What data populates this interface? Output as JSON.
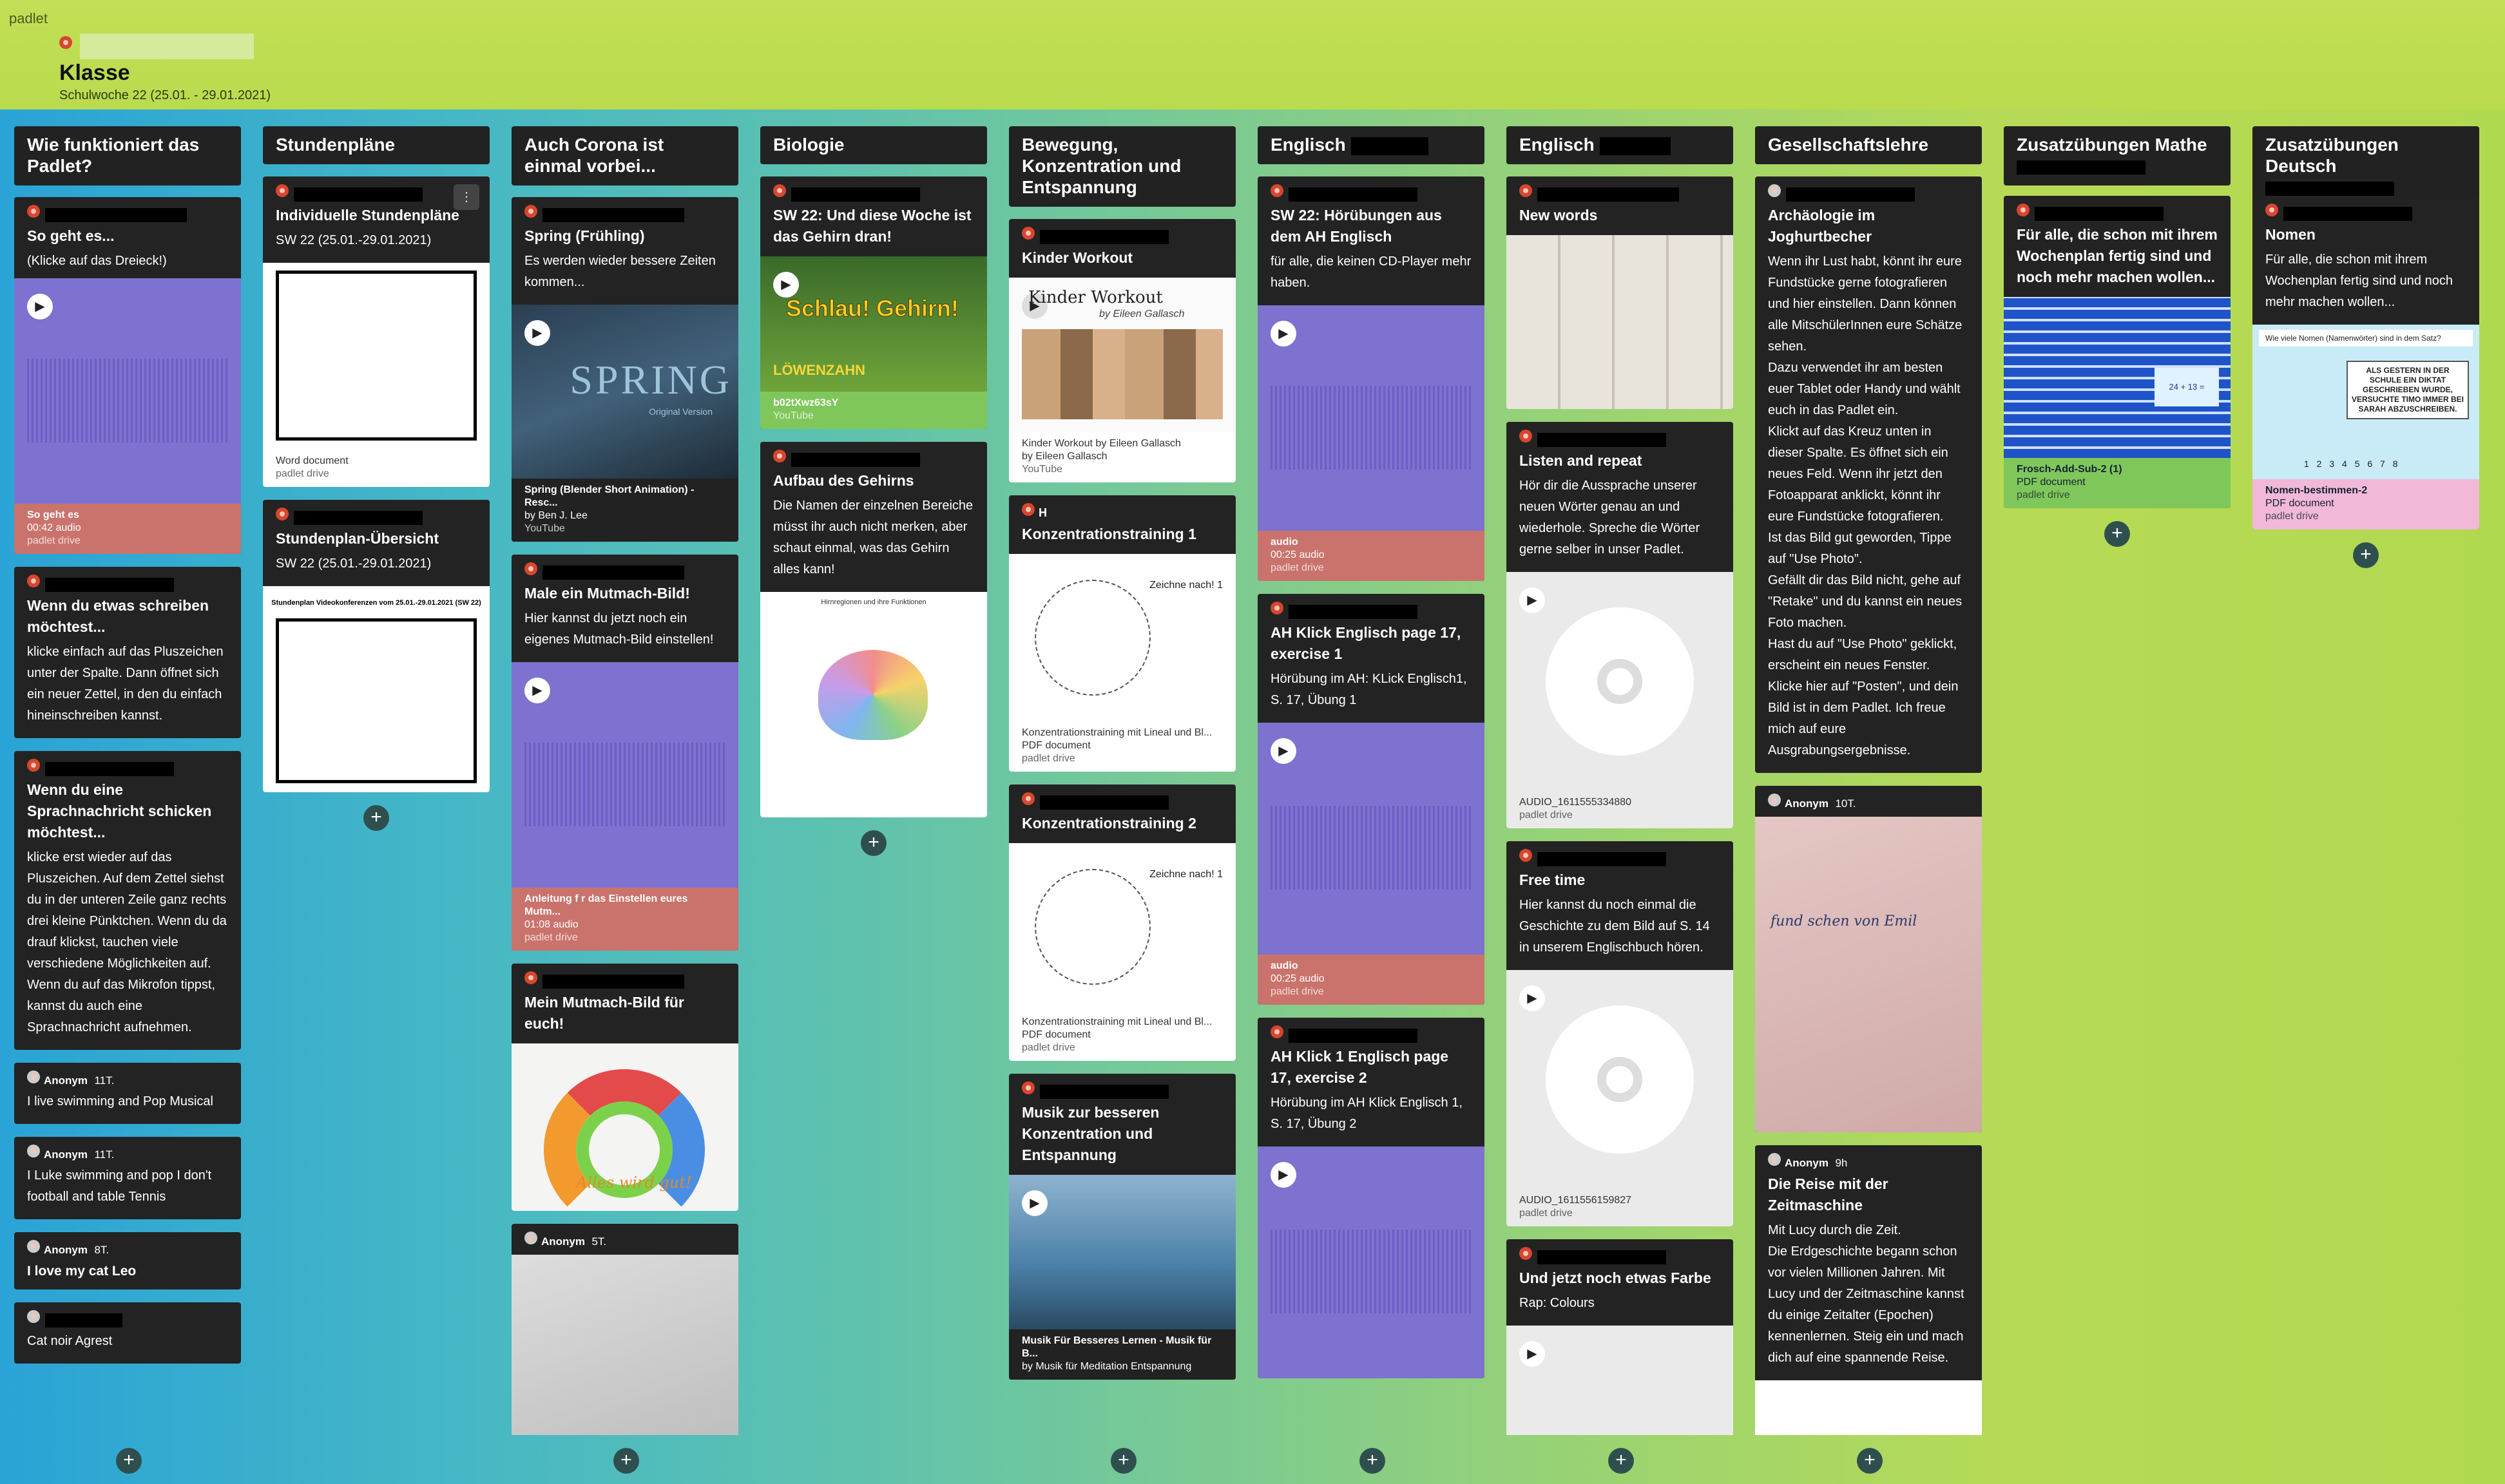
{
  "app": {
    "name": "padlet"
  },
  "header": {
    "title": "Klasse",
    "subtitle": "Schulwoche 22 (25.01. - 29.01.2021)"
  },
  "columns": [
    {
      "title": "Wie funktioniert das Padlet?",
      "posts": [
        {
          "title": "So geht es...",
          "body": "(Klicke auf das Dreieck!)",
          "att_name": "So geht es",
          "att_meta": "00:42 audio",
          "att_src": "padlet drive"
        },
        {
          "title": "Wenn du etwas schreiben möchtest...",
          "body": "klicke einfach auf das Pluszeichen unter der Spalte. Dann öffnet sich ein neuer Zettel, in den du einfach hineinschreiben kannst."
        },
        {
          "title": "Wenn du eine Sprachnachricht schicken möchtest...",
          "body": "klicke erst wieder auf das Pluszeichen. Auf dem Zettel siehst du in der unteren Zeile ganz rechts drei kleine Pünktchen. Wenn du da drauf klickst, tauchen viele verschiedene Möglichkeiten auf. Wenn du auf das Mikrofon tippst, kannst du auch eine Sprachnachricht aufnehmen."
        },
        {
          "author": "Anonym",
          "time": "11T.",
          "body": "I live swimming and Pop Musical"
        },
        {
          "author": "Anonym",
          "time": "11T.",
          "body": "I Luke swimming and pop  I don't football and table Tennis"
        },
        {
          "author": "Anonym",
          "time": "8T.",
          "body": "I love my cat Leo"
        },
        {
          "body": "Cat noir Agrest"
        }
      ]
    },
    {
      "title": "Stundenpläne",
      "posts": [
        {
          "title": "Individuelle Stundenpläne",
          "body": "SW 22 (25.01.-29.01.2021)",
          "att_name": "Word document",
          "att_src": "padlet drive"
        },
        {
          "title": "Stundenplan-Übersicht",
          "body": "SW 22 (25.01.-29.01.2021)",
          "doc_heading": "Stundenplan Videokonferenzen vom 25.01.-29.01.2021 (SW 22)"
        }
      ]
    },
    {
      "title": "Auch Corona ist einmal vorbei...",
      "posts": [
        {
          "title": "Spring (Frühling)",
          "body": "Es werden wieder bessere Zeiten kommen...",
          "img_text": "SPRING",
          "img_sub": "Original Version",
          "att_name": "Spring (Blender Short Animation) - Resc...",
          "att_meta": "by Ben J. Lee",
          "att_src": "YouTube"
        },
        {
          "title": "Male ein Mutmach-Bild!",
          "body": "Hier kannst du jetzt noch ein eigenes Mutmach-Bild einstellen!",
          "att_name": "Anleitung f r das Einstellen eures Mutm...",
          "att_meta": "01:08 audio",
          "att_src": "padlet drive"
        },
        {
          "title": "Mein Mutmach-Bild für euch!",
          "img_text": "Alles wird gut!"
        },
        {
          "author": "Anonym",
          "time": "5T."
        }
      ]
    },
    {
      "title": "Biologie",
      "posts": [
        {
          "title": "SW 22: Und diese Woche ist das Gehirn dran!",
          "img_text": "Schlau! Gehirn!",
          "img_sub": "LÖWENZAHN",
          "att_name": "b02tXwz63sY",
          "att_src": "YouTube"
        },
        {
          "title": "Aufbau des Gehirns",
          "body": "Die Namen der einzelnen Bereiche müsst ihr auch nicht merken, aber schaut einmal, was das Gehirn alles kann!",
          "img_text": "Hirnregionen und ihre Funktionen"
        }
      ]
    },
    {
      "title": "Bewegung, Konzentration und Entspannung",
      "posts": [
        {
          "title": "Kinder Workout",
          "img_text": "Kinder Workout",
          "img_sub": "by Eileen Gallasch",
          "att_name": "Kinder Workout by Eileen Gallasch",
          "att_meta": "by Eileen Gallasch",
          "att_src": "YouTube"
        },
        {
          "author_initial": "H",
          "title": "Konzentrationstraining 1",
          "img_text": "Zeichne nach! 1",
          "att_name": "Konzentrationstraining mit Lineal und Bl...",
          "att_meta": "PDF document",
          "att_src": "padlet drive"
        },
        {
          "title": "Konzentrationstraining 2",
          "img_text": "Zeichne nach! 1",
          "att_name": "Konzentrationstraining mit Lineal und Bl...",
          "att_meta": "PDF document",
          "att_src": "padlet drive"
        },
        {
          "title": "Musik zur besseren Konzentration und Entspannung",
          "att_name": "Musik Für Besseres Lernen - Musik für B...",
          "att_meta": "by Musik für Meditation Entspannung"
        }
      ]
    },
    {
      "title": "Englisch",
      "posts": [
        {
          "title": "SW 22: Hörübungen aus dem AH Englisch",
          "body": "für alle, die keinen CD-Player mehr haben.",
          "att_name": "audio",
          "att_meta": "00:25 audio",
          "att_src": "padlet drive"
        },
        {
          "title": "AH Klick Englisch page 17, exercise 1",
          "body": "Hörübung im  AH: KLick Englisch1, S. 17, Übung 1",
          "att_name": "audio",
          "att_meta": "00:25 audio",
          "att_src": "padlet drive"
        },
        {
          "title": "AH Klick 1 Englisch page 17, exercise 2",
          "body": "Hörübung im AH Klick Englisch 1, S. 17, Übung 2"
        }
      ]
    },
    {
      "title": "Englisch",
      "posts": [
        {
          "title": "New words"
        },
        {
          "title": "Listen and repeat",
          "body": "Hör dir die Aussprache unserer neuen Wörter genau an und wiederhole.  Spreche die Wörter gerne selber in unser Padlet.",
          "att_name": "AUDIO_1611555334880",
          "att_src": "padlet drive"
        },
        {
          "title": "Free time",
          "body": "Hier kannst du noch einmal die Geschichte zu dem Bild auf S. 14 in unserem Englischbuch hören.",
          "att_name": "AUDIO_1611556159827",
          "att_src": "padlet drive"
        },
        {
          "title": "Und jetzt noch etwas Farbe",
          "body": "Rap: Colours"
        }
      ]
    },
    {
      "title": "Gesellschaftslehre",
      "posts": [
        {
          "title": "Archäologie im Joghurtbecher",
          "body": "Wenn ihr Lust habt, könnt ihr eure Fundstücke gerne fotografieren und hier einstellen. Dann können alle MitschülerInnen eure Schätze sehen.\nDazu verwendet ihr am besten euer Tablet oder Handy und wählt euch in das Padlet ein.\nKlickt auf das Kreuz unten  in dieser Spalte. Es öffnet sich ein neues Feld. Wenn ihr jetzt den Fotoapparat anklickt, könnt ihr eure Fundstücke fotografieren.\nIst das Bild gut geworden, Tippe auf \"Use Photo\".\nGefällt dir das Bild nicht, gehe auf \"Retake\" und du kannst ein neues Foto machen.\nHast du auf \"Use Photo\" geklickt, erscheint ein  neues Fenster.\nKlicke hier auf \"Posten\", und dein Bild ist in dem Padlet. Ich freue mich auf eure Ausgrabungsergebnisse."
        },
        {
          "author": "Anonym",
          "time": "10T.",
          "img_text": "fund schen von Emil"
        },
        {
          "author": "Anonym",
          "time": "9h",
          "title": "Die Reise mit der Zeitmaschine",
          "body": "Mit Lucy durch die Zeit.\nDie Erdgeschichte begann schon vor vielen Millionen Jahren. Mit Lucy und der Zeitmaschine kannst du einige Zeitalter (Epochen) kennenlernen. Steig ein und mach dich auf eine spannende Reise."
        }
      ]
    },
    {
      "title": "Zusatzübungen Mathe",
      "posts": [
        {
          "title": "Für alle, die schon mit ihrem Wochenplan fertig sind und noch mehr machen wollen...",
          "img_text": "24 + 13 =",
          "att_name": "Frosch-Add-Sub-2 (1)",
          "att_meta": "PDF document",
          "att_src": "padlet drive"
        }
      ]
    },
    {
      "title": "Zusatzübungen Deutsch",
      "posts": [
        {
          "title": "Nomen",
          "body": "Für alle, die schon mit ihrem Wochenplan fertig sind und noch mehr machen wollen...",
          "img_text": "Wie viele Nomen (Namenwörter) sind in dem Satz?",
          "img_sub": "ALS GESTERN IN DER SCHULE EIN DIKTAT GESCHRIEBEN WURDE, VERSUCHTE TIMO IMMER BEI SARAH ABZUSCHREIBEN.",
          "img_nums": "1 2 3 4 5 6 7 8",
          "att_name": "Nomen-bestimmen-2",
          "att_meta": "PDF document",
          "att_src": "padlet drive"
        }
      ]
    }
  ],
  "add_symbol": "+",
  "colors": {
    "audio": "#7d72cf",
    "att_red": "#c9736c",
    "att_green": "#7fc75a",
    "att_pink": "#f2b8d8"
  }
}
